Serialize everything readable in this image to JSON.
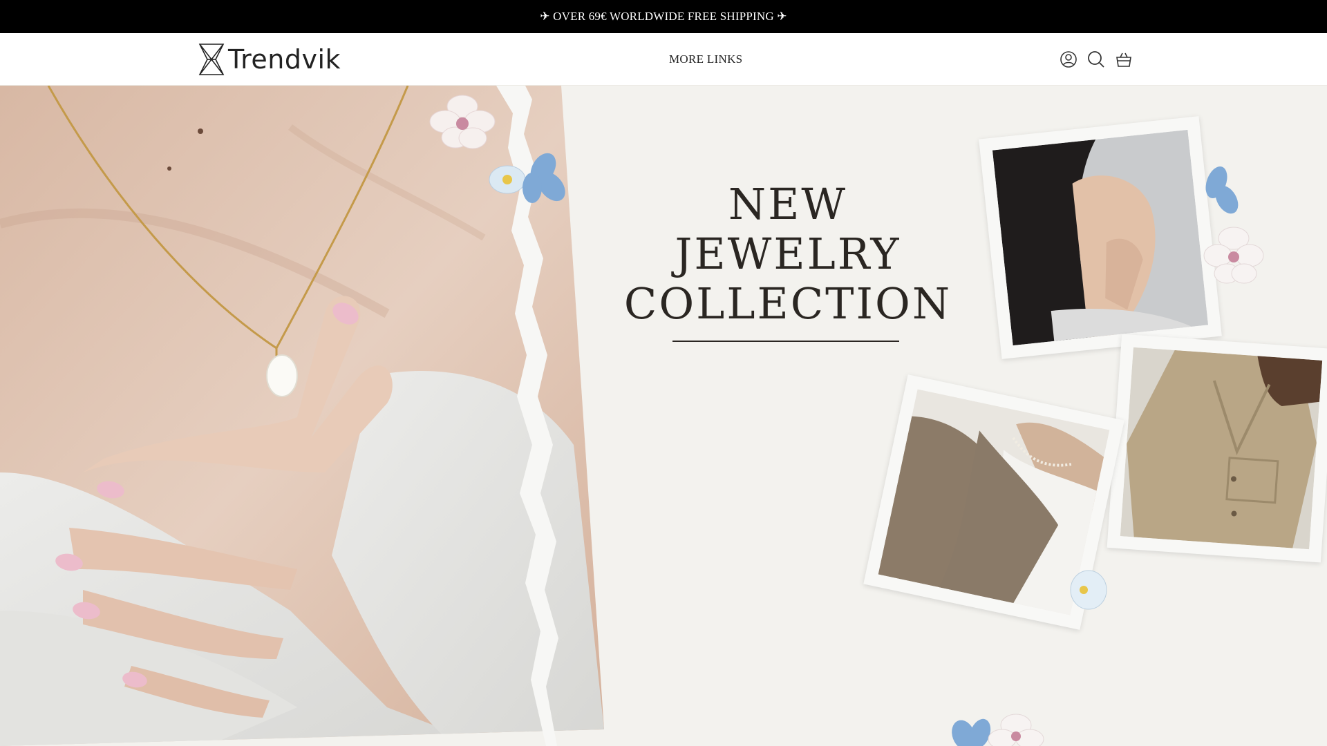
{
  "announcement": {
    "text": "✈ OVER 69€ WORLDWIDE FREE SHIPPING ✈"
  },
  "header": {
    "logo_text": "Trendvik",
    "nav_link": "MORE LINKS",
    "icons": [
      "account-icon",
      "search-icon",
      "cart-icon"
    ]
  },
  "hero": {
    "headline": [
      "NEW",
      "JEWELRY",
      "COLLECTION"
    ]
  },
  "colors": {
    "announce_bg": "#000000",
    "page_bg": "#f3f2ee",
    "text": "#2a2622"
  }
}
